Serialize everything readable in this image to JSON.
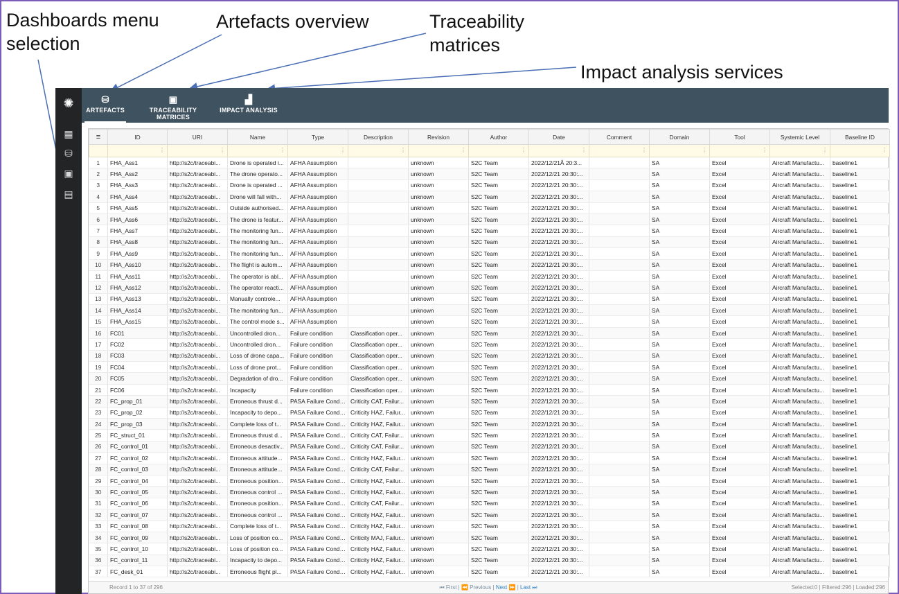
{
  "callouts": {
    "dashboards": [
      "Dashboards menu",
      "selection"
    ],
    "artefacts": "Artefacts overview",
    "traceability": [
      "Traceability",
      "matrices"
    ],
    "impact": "Impact analysis services"
  },
  "sidebar": {
    "logo_icon": "logo-icon",
    "items": [
      {
        "name": "dashboard-grid-icon",
        "glyph": "▦"
      },
      {
        "name": "database-settings-icon",
        "glyph": "⛁"
      },
      {
        "name": "monitor-icon",
        "glyph": "▣"
      },
      {
        "name": "dashboard-settings-icon",
        "glyph": "▤"
      }
    ]
  },
  "tabs": [
    {
      "label": "ARTEFACTS",
      "icon": "database-icon",
      "glyph": "⛁",
      "active": true
    },
    {
      "label": "TRACEABILITY MATRICES",
      "icon": "matrix-icon",
      "glyph": "▣",
      "active": false
    },
    {
      "label": "IMPACT ANALYSIS",
      "icon": "bar-chart-icon",
      "glyph": "▟",
      "active": false
    }
  ],
  "grid": {
    "menu_glyph": "≡",
    "columns": [
      "ID",
      "URI",
      "Name",
      "Type",
      "Description",
      "Revision",
      "Author",
      "Date",
      "Comment",
      "Domain",
      "Tool",
      "Systemic Level",
      "Baseline ID"
    ],
    "rows": [
      [
        "1",
        "FHA_Ass1",
        "http://s2c/traceabi...",
        "Drone is operated i...",
        "AFHA Assumption",
        "",
        "unknown",
        "S2C Team",
        "2022/12/21Â 20:3...",
        "",
        "SA",
        "Excel",
        "Aircraft Manufactu...",
        "baseline1"
      ],
      [
        "2",
        "FHA_Ass2",
        "http://s2c/traceabi...",
        "The drone operato...",
        "AFHA Assumption",
        "",
        "unknown",
        "S2C Team",
        "2022/12/21 20:30:...",
        "",
        "SA",
        "Excel",
        "Aircraft Manufactu...",
        "baseline1"
      ],
      [
        "3",
        "FHA_Ass3",
        "http://s2c/traceabi...",
        "Drone is operated ...",
        "AFHA Assumption",
        "",
        "unknown",
        "S2C Team",
        "2022/12/21 20:30:...",
        "",
        "SA",
        "Excel",
        "Aircraft Manufactu...",
        "baseline1"
      ],
      [
        "4",
        "FHA_Ass4",
        "http://s2c/traceabi...",
        "Drone will fall with...",
        "AFHA Assumption",
        "",
        "unknown",
        "S2C Team",
        "2022/12/21 20:30:...",
        "",
        "SA",
        "Excel",
        "Aircraft Manufactu...",
        "baseline1"
      ],
      [
        "5",
        "FHA_Ass5",
        "http://s2c/traceabi...",
        "Outside authorised...",
        "AFHA Assumption",
        "",
        "unknown",
        "S2C Team",
        "2022/12/21 20:30:...",
        "",
        "SA",
        "Excel",
        "Aircraft Manufactu...",
        "baseline1"
      ],
      [
        "6",
        "FHA_Ass6",
        "http://s2c/traceabi...",
        "The drone is featur...",
        "AFHA Assumption",
        "",
        "unknown",
        "S2C Team",
        "2022/12/21 20:30:...",
        "",
        "SA",
        "Excel",
        "Aircraft Manufactu...",
        "baseline1"
      ],
      [
        "7",
        "FHA_Ass7",
        "http://s2c/traceabi...",
        "The monitoring fun...",
        "AFHA Assumption",
        "",
        "unknown",
        "S2C Team",
        "2022/12/21 20:30:...",
        "",
        "SA",
        "Excel",
        "Aircraft Manufactu...",
        "baseline1"
      ],
      [
        "8",
        "FHA_Ass8",
        "http://s2c/traceabi...",
        "The monitoring fun...",
        "AFHA Assumption",
        "",
        "unknown",
        "S2C Team",
        "2022/12/21 20:30:...",
        "",
        "SA",
        "Excel",
        "Aircraft Manufactu...",
        "baseline1"
      ],
      [
        "9",
        "FHA_Ass9",
        "http://s2c/traceabi...",
        "The monitoring fun...",
        "AFHA Assumption",
        "",
        "unknown",
        "S2C Team",
        "2022/12/21 20:30:...",
        "",
        "SA",
        "Excel",
        "Aircraft Manufactu...",
        "baseline1"
      ],
      [
        "10",
        "FHA_Ass10",
        "http://s2c/traceabi...",
        "The flight is autom...",
        "AFHA Assumption",
        "",
        "unknown",
        "S2C Team",
        "2022/12/21 20:30:...",
        "",
        "SA",
        "Excel",
        "Aircraft Manufactu...",
        "baseline1"
      ],
      [
        "11",
        "FHA_Ass11",
        "http://s2c/traceabi...",
        "The operator is abl...",
        "AFHA Assumption",
        "",
        "unknown",
        "S2C Team",
        "2022/12/21 20:30:...",
        "",
        "SA",
        "Excel",
        "Aircraft Manufactu...",
        "baseline1"
      ],
      [
        "12",
        "FHA_Ass12",
        "http://s2c/traceabi...",
        "The operator reacti...",
        "AFHA Assumption",
        "",
        "unknown",
        "S2C Team",
        "2022/12/21 20:30:...",
        "",
        "SA",
        "Excel",
        "Aircraft Manufactu...",
        "baseline1"
      ],
      [
        "13",
        "FHA_Ass13",
        "http://s2c/traceabi...",
        "Manually controle...",
        "AFHA Assumption",
        "",
        "unknown",
        "S2C Team",
        "2022/12/21 20:30:...",
        "",
        "SA",
        "Excel",
        "Aircraft Manufactu...",
        "baseline1"
      ],
      [
        "14",
        "FHA_Ass14",
        "http://s2c/traceabi...",
        "The monitoring fun...",
        "AFHA Assumption",
        "",
        "unknown",
        "S2C Team",
        "2022/12/21 20:30:...",
        "",
        "SA",
        "Excel",
        "Aircraft Manufactu...",
        "baseline1"
      ],
      [
        "15",
        "FHA_Ass15",
        "http://s2c/traceabi...",
        "The control mode s...",
        "AFHA Assumption",
        "",
        "unknown",
        "S2C Team",
        "2022/12/21 20:30:...",
        "",
        "SA",
        "Excel",
        "Aircraft Manufactu...",
        "baseline1"
      ],
      [
        "16",
        "FC01",
        "http://s2c/traceabi...",
        "Uncontrolled dron...",
        "Failure condition",
        "Classification oper...",
        "unknown",
        "S2C Team",
        "2022/12/21 20:30:...",
        "",
        "SA",
        "Excel",
        "Aircraft Manufactu...",
        "baseline1"
      ],
      [
        "17",
        "FC02",
        "http://s2c/traceabi...",
        "Uncontrolled dron...",
        "Failure condition",
        "Classification oper...",
        "unknown",
        "S2C Team",
        "2022/12/21 20:30:...",
        "",
        "SA",
        "Excel",
        "Aircraft Manufactu...",
        "baseline1"
      ],
      [
        "18",
        "FC03",
        "http://s2c/traceabi...",
        "Loss of drone capa...",
        "Failure condition",
        "Classification oper...",
        "unknown",
        "S2C Team",
        "2022/12/21 20:30:...",
        "",
        "SA",
        "Excel",
        "Aircraft Manufactu...",
        "baseline1"
      ],
      [
        "19",
        "FC04",
        "http://s2c/traceabi...",
        "Loss of drone prot...",
        "Failure condition",
        "Classification oper...",
        "unknown",
        "S2C Team",
        "2022/12/21 20:30:...",
        "",
        "SA",
        "Excel",
        "Aircraft Manufactu...",
        "baseline1"
      ],
      [
        "20",
        "FC05",
        "http://s2c/traceabi...",
        "Degradation of dro...",
        "Failure condition",
        "Classification oper...",
        "unknown",
        "S2C Team",
        "2022/12/21 20:30:...",
        "",
        "SA",
        "Excel",
        "Aircraft Manufactu...",
        "baseline1"
      ],
      [
        "21",
        "FC06",
        "http://s2c/traceabi...",
        "Incapacity",
        "Failure condition",
        "Classification oper...",
        "unknown",
        "S2C Team",
        "2022/12/21 20:30:...",
        "",
        "SA",
        "Excel",
        "Aircraft Manufactu...",
        "baseline1"
      ],
      [
        "22",
        "FC_prop_01",
        "http://s2c/traceabi...",
        "Erroneous thrust d...",
        "PASA Failure Condi...",
        "Criticity CAT, Failur...",
        "unknown",
        "S2C Team",
        "2022/12/21 20:30:...",
        "",
        "SA",
        "Excel",
        "Aircraft Manufactu...",
        "baseline1"
      ],
      [
        "23",
        "FC_prop_02",
        "http://s2c/traceabi...",
        "Incapacity to depo...",
        "PASA Failure Condi...",
        "Criticity HAZ, Failur...",
        "unknown",
        "S2C Team",
        "2022/12/21 20:30:...",
        "",
        "SA",
        "Excel",
        "Aircraft Manufactu...",
        "baseline1"
      ],
      [
        "24",
        "FC_prop_03",
        "http://s2c/traceabi...",
        "Complete loss of t...",
        "PASA Failure Condi...",
        "Criticity HAZ, Failur...",
        "unknown",
        "S2C Team",
        "2022/12/21 20:30:...",
        "",
        "SA",
        "Excel",
        "Aircraft Manufactu...",
        "baseline1"
      ],
      [
        "25",
        "FC_struct_01",
        "http://s2c/traceabi...",
        "Erroneous thrust d...",
        "PASA Failure Condi...",
        "Criticity CAT, Failur...",
        "unknown",
        "S2C Team",
        "2022/12/21 20:30:...",
        "",
        "SA",
        "Excel",
        "Aircraft Manufactu...",
        "baseline1"
      ],
      [
        "26",
        "FC_control_01",
        "http://s2c/traceabi...",
        "Erroneous desactiv...",
        "PASA Failure Condi...",
        "Criticity CAT, Failur...",
        "unknown",
        "S2C Team",
        "2022/12/21 20:30:...",
        "",
        "SA",
        "Excel",
        "Aircraft Manufactu...",
        "baseline1"
      ],
      [
        "27",
        "FC_control_02",
        "http://s2c/traceabi...",
        "Erroneous attitude...",
        "PASA Failure Condi...",
        "Criticity HAZ, Failur...",
        "unknown",
        "S2C Team",
        "2022/12/21 20:30:...",
        "",
        "SA",
        "Excel",
        "Aircraft Manufactu...",
        "baseline1"
      ],
      [
        "28",
        "FC_control_03",
        "http://s2c/traceabi...",
        "Erroneous attitude...",
        "PASA Failure Condi...",
        "Criticity CAT, Failur...",
        "unknown",
        "S2C Team",
        "2022/12/21 20:30:...",
        "",
        "SA",
        "Excel",
        "Aircraft Manufactu...",
        "baseline1"
      ],
      [
        "29",
        "FC_control_04",
        "http://s2c/traceabi...",
        "Erroneous position...",
        "PASA Failure Condi...",
        "Criticity HAZ, Failur...",
        "unknown",
        "S2C Team",
        "2022/12/21 20:30:...",
        "",
        "SA",
        "Excel",
        "Aircraft Manufactu...",
        "baseline1"
      ],
      [
        "30",
        "FC_control_05",
        "http://s2c/traceabi...",
        "Erroneous control ...",
        "PASA Failure Condi...",
        "Criticity HAZ, Failur...",
        "unknown",
        "S2C Team",
        "2022/12/21 20:30:...",
        "",
        "SA",
        "Excel",
        "Aircraft Manufactu...",
        "baseline1"
      ],
      [
        "31",
        "FC_control_06",
        "http://s2c/traceabi...",
        "Erroneous position...",
        "PASA Failure Condi...",
        "Criticity CAT, Failur...",
        "unknown",
        "S2C Team",
        "2022/12/21 20:30:...",
        "",
        "SA",
        "Excel",
        "Aircraft Manufactu...",
        "baseline1"
      ],
      [
        "32",
        "FC_control_07",
        "http://s2c/traceabi...",
        "Erroneous control ...",
        "PASA Failure Condi...",
        "Criticity HAZ, Failur...",
        "unknown",
        "S2C Team",
        "2022/12/21 20:30:...",
        "",
        "SA",
        "Excel",
        "Aircraft Manufactu...",
        "baseline1"
      ],
      [
        "33",
        "FC_control_08",
        "http://s2c/traceabi...",
        "Complete loss of t...",
        "PASA Failure Condi...",
        "Criticity HAZ, Failur...",
        "unknown",
        "S2C Team",
        "2022/12/21 20:30:...",
        "",
        "SA",
        "Excel",
        "Aircraft Manufactu...",
        "baseline1"
      ],
      [
        "34",
        "FC_control_09",
        "http://s2c/traceabi...",
        "Loss of position co...",
        "PASA Failure Condi...",
        "Criticity MAJ, Failur...",
        "unknown",
        "S2C Team",
        "2022/12/21 20:30:...",
        "",
        "SA",
        "Excel",
        "Aircraft Manufactu...",
        "baseline1"
      ],
      [
        "35",
        "FC_control_10",
        "http://s2c/traceabi...",
        "Loss of position co...",
        "PASA Failure Condi...",
        "Criticity HAZ, Failur...",
        "unknown",
        "S2C Team",
        "2022/12/21 20:30:...",
        "",
        "SA",
        "Excel",
        "Aircraft Manufactu...",
        "baseline1"
      ],
      [
        "36",
        "FC_control_11",
        "http://s2c/traceabi...",
        "Incapacity to depo...",
        "PASA Failure Condi...",
        "Criticity HAZ, Failur...",
        "unknown",
        "S2C Team",
        "2022/12/21 20:30:...",
        "",
        "SA",
        "Excel",
        "Aircraft Manufactu...",
        "baseline1"
      ],
      [
        "37",
        "FC_desk_01",
        "http://s2c/traceabi...",
        "Erroneous flight pl...",
        "PASA Failure Condi...",
        "Criticity HAZ, Failur...",
        "unknown",
        "S2C Team",
        "2022/12/21 20:30:...",
        "",
        "SA",
        "Excel",
        "Aircraft Manufactu...",
        "baseline1"
      ]
    ]
  },
  "footer": {
    "record_text": "Record 1 to 37 of 296",
    "first": "⏮ First",
    "previous": "⏪ Previous",
    "next": "Next ⏩",
    "last": "Last ⏭",
    "separator": "|",
    "selected": "Selected:0",
    "filtered": "Filtered:296",
    "loaded": "Loaded:296"
  },
  "colors": {
    "frame": "#7b5cb8",
    "topbar": "#3f5260",
    "sidebar": "#222426",
    "arrow": "#4a6fb5"
  }
}
